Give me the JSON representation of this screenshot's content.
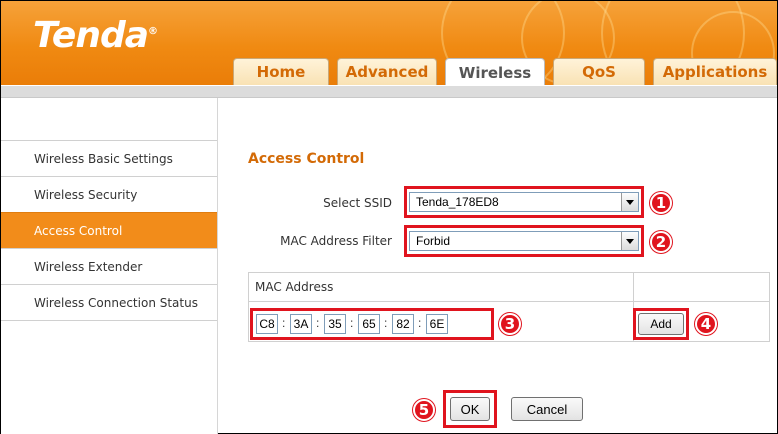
{
  "header": {
    "logo": "Tenda",
    "logo_mark": "®",
    "tabs": [
      {
        "label": "Home",
        "active": false
      },
      {
        "label": "Advanced",
        "active": false
      },
      {
        "label": "Wireless",
        "active": true
      },
      {
        "label": "QoS",
        "active": false
      },
      {
        "label": "Applications",
        "active": false
      }
    ]
  },
  "sidebar": {
    "items": [
      {
        "label": "Wireless Basic Settings",
        "active": false
      },
      {
        "label": "Wireless Security",
        "active": false
      },
      {
        "label": "Access Control",
        "active": true
      },
      {
        "label": "Wireless Extender",
        "active": false
      },
      {
        "label": "Wireless Connection Status",
        "active": false
      }
    ]
  },
  "main": {
    "section_title": "Access Control",
    "select_ssid": {
      "label": "Select SSID",
      "value": "Tenda_178ED8"
    },
    "mac_filter": {
      "label": "MAC Address Filter",
      "value": "Forbid"
    },
    "mac_table": {
      "header": "MAC Address",
      "segments": [
        "C8",
        "3A",
        "35",
        "65",
        "82",
        "6E"
      ],
      "separator": ":",
      "add_label": "Add"
    },
    "ok_label": "OK",
    "cancel_label": "Cancel"
  },
  "callouts": [
    "1",
    "2",
    "3",
    "4",
    "5"
  ],
  "colors": {
    "accent": "#f08a12",
    "callout": "#e0141e",
    "active_tab_text": "#555555",
    "tab_text": "#d36a06"
  }
}
